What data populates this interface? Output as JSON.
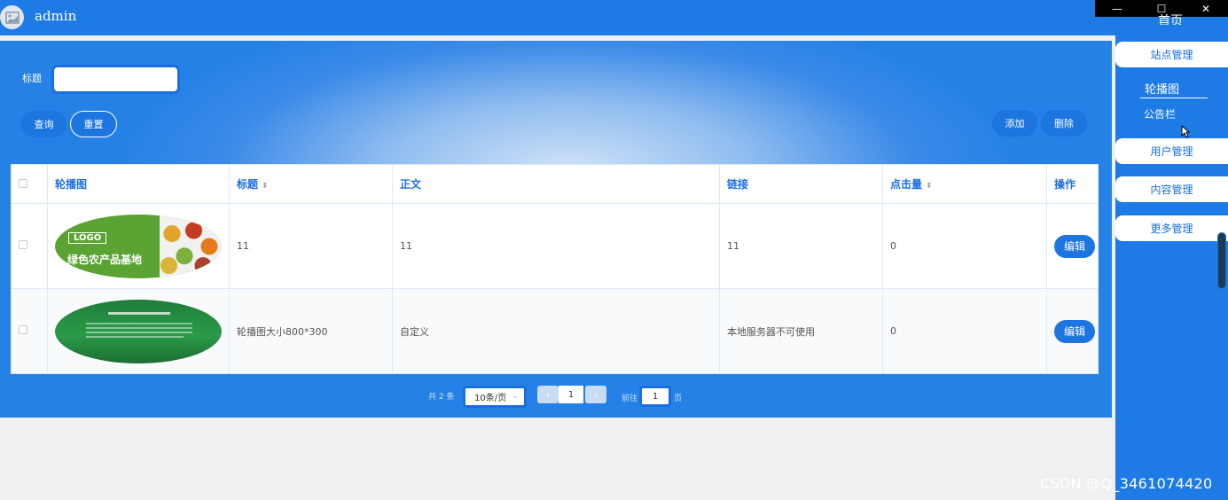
{
  "header": {
    "title": "admin"
  },
  "window_controls": {
    "minimize": "—",
    "maximize": "☐",
    "close": "✕"
  },
  "search": {
    "label": "标题",
    "value": "",
    "placeholder": ""
  },
  "buttons": {
    "query": "查询",
    "reset": "重置",
    "add": "添加",
    "delete": "删除"
  },
  "table": {
    "columns": [
      "轮播图",
      "标题",
      "正文",
      "链接",
      "点击量",
      "操作"
    ],
    "sort_icon": "⬍",
    "rows": [
      {
        "title": "11",
        "body": "11",
        "link": "11",
        "clicks": "0",
        "action": "编辑"
      },
      {
        "title": "轮播图大小800*300",
        "body": "自定义",
        "link": "本地服务器不可使用",
        "clicks": "0",
        "action": "编辑"
      }
    ],
    "banner1": {
      "logo": "LOGO",
      "title": "绿色农产品基地"
    }
  },
  "pagination": {
    "total": "共 2 条",
    "page_size": "10条/页",
    "prev": "‹",
    "next": "›",
    "current_page": "1",
    "goto_label": "前往",
    "goto_value": "1",
    "page_label": "页"
  },
  "nav": {
    "home": "首页",
    "site_mgmt": "站点管理",
    "carousel": "轮播图",
    "notice": "公告栏",
    "user_mgmt": "用户管理",
    "content_mgmt": "内容管理",
    "more_mgmt": "更多管理"
  },
  "watermark": "CSDN @Q_3461074420",
  "colors": {
    "primary": "#1e7be6",
    "accent": "#1a6fe0"
  }
}
